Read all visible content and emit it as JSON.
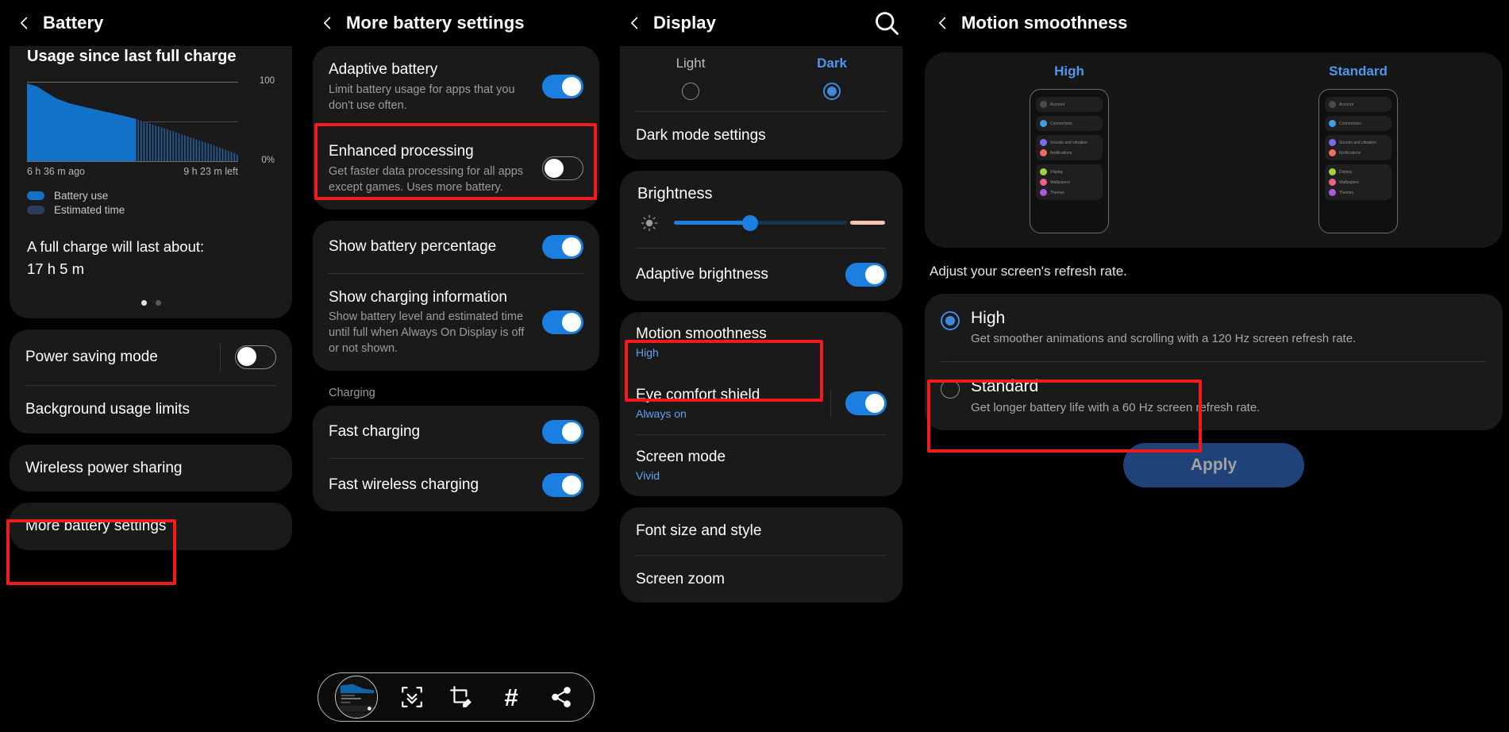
{
  "panel_battery": {
    "title": "Battery",
    "back_icon": "chevron-left-icon",
    "usage_heading": "Usage since last full charge",
    "axis_top": "100",
    "axis_bottom": "0%",
    "time_start": "6 h 36 m ago",
    "time_end": "9 h 23 m left",
    "legend": [
      {
        "label": "Battery use",
        "color": "#1172c7"
      },
      {
        "label": "Estimated time",
        "color": "#2b3d5a"
      }
    ],
    "full_charge_label": "A full charge will last about:",
    "full_charge_value": "17 h 5 m",
    "page_dots": 2,
    "page_dot_active": 0,
    "items": [
      {
        "label": "Power saving mode",
        "toggle": "off"
      },
      {
        "label": "Background usage limits"
      },
      {
        "label": "Wireless power sharing"
      },
      {
        "label": "More battery settings",
        "highlighted": true
      }
    ]
  },
  "panel_more_battery": {
    "title": "More battery settings",
    "back_icon": "chevron-left-icon",
    "items": [
      {
        "label": "Adaptive battery",
        "sub": "Limit battery usage for apps that you don't use often.",
        "toggle": "on"
      },
      {
        "label": "Enhanced processing",
        "sub": "Get faster data processing for all apps except games. Uses more battery.",
        "toggle": "off",
        "highlighted": true
      },
      {
        "label": "Show battery percentage",
        "toggle": "on"
      },
      {
        "label": "Show charging information",
        "sub": "Show battery level and estimated time until full when Always On Display is off or not shown.",
        "toggle": "on"
      }
    ],
    "section_charging": "Charging",
    "charging_items": [
      {
        "label": "Fast charging",
        "toggle": "on"
      },
      {
        "label": "Fast wireless charging",
        "toggle": "on"
      }
    ],
    "screenshot_toolbar": {
      "thumbnail_name": "screenshot-thumbnail",
      "icons": [
        {
          "name": "scroll-capture-icon"
        },
        {
          "name": "crop-edit-icon"
        },
        {
          "name": "hashtag-tag-icon",
          "glyph": "#"
        },
        {
          "name": "share-icon"
        }
      ]
    }
  },
  "panel_display": {
    "title": "Display",
    "back_icon": "chevron-left-icon",
    "search_icon": "search-icon",
    "modes": [
      {
        "label": "Light",
        "selected": false
      },
      {
        "label": "Dark",
        "selected": true
      }
    ],
    "dark_mode_settings": "Dark mode settings",
    "brightness_title": "Brightness",
    "brightness_percent": 38,
    "sun_icon": "brightness-sun-icon",
    "items": [
      {
        "label": "Adaptive brightness",
        "toggle": "on"
      },
      {
        "label": "Motion smoothness",
        "sub": "High",
        "highlighted": true
      },
      {
        "label": "Eye comfort shield",
        "sub": "Always on",
        "toggle": "on"
      },
      {
        "label": "Screen mode",
        "sub": "Vivid"
      },
      {
        "label": "Font size and style"
      },
      {
        "label": "Screen zoom"
      }
    ]
  },
  "panel_motion_smoothness": {
    "title": "Motion smoothness",
    "back_icon": "chevron-left-icon",
    "previews": [
      {
        "label": "High",
        "rows": [
          {
            "text": "Account",
            "color": ""
          },
          {
            "text": "Connections",
            "color": "#3fa0e8"
          },
          {
            "text": "Sounds and vibration",
            "color": "#7b6bf0"
          },
          {
            "text": "Notifications",
            "color": "#ef6f5e"
          },
          {
            "text": "Display",
            "color": "#9fd23c"
          },
          {
            "text": "Wallpapers",
            "color": "#ef5f8a"
          },
          {
            "text": "Themes",
            "color": "#a75ce0"
          }
        ]
      },
      {
        "label": "Standard",
        "rows": [
          {
            "text": "Account",
            "color": ""
          },
          {
            "text": "Connections",
            "color": "#3fa0e8"
          },
          {
            "text": "Sounds and vibration",
            "color": "#7b6bf0"
          },
          {
            "text": "Notifications",
            "color": "#ef6f5e"
          },
          {
            "text": "Display",
            "color": "#9fd23c"
          },
          {
            "text": "Wallpapers",
            "color": "#ef5f8a"
          },
          {
            "text": "Themes",
            "color": "#a75ce0"
          }
        ]
      }
    ],
    "description": "Adjust your screen's refresh rate.",
    "options": [
      {
        "label": "High",
        "sub": "Get smoother animations and scrolling with a 120 Hz screen refresh rate.",
        "selected": true,
        "highlighted": false
      },
      {
        "label": "Standard",
        "sub": "Get longer battery life with a 60 Hz screen refresh rate.",
        "selected": false,
        "highlighted": true
      }
    ],
    "apply_label": "Apply"
  },
  "colors": {
    "accent_blue": "#1a7fe0",
    "link_blue": "#4f96ec",
    "highlight_red": "#f11b1b",
    "card_bg": "#1a1a1a",
    "page_bg": "#000000"
  }
}
